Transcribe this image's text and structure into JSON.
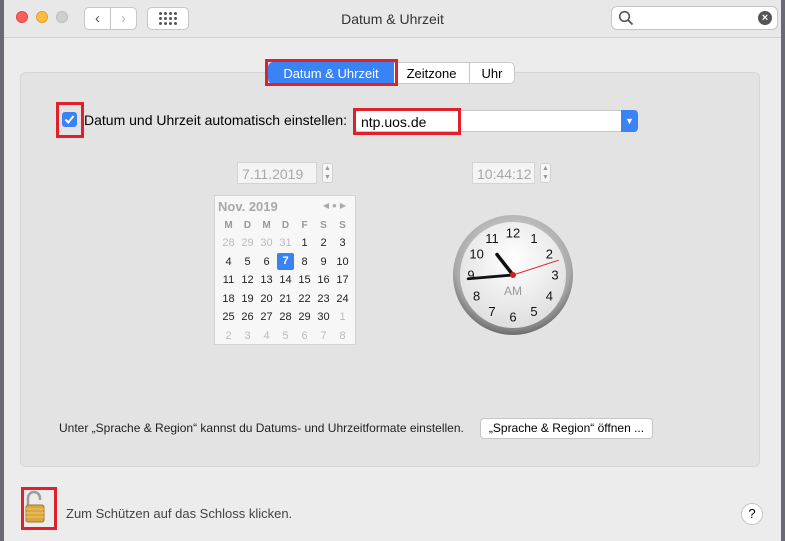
{
  "window": {
    "title": "Datum & Uhrzeit"
  },
  "toolbar": {
    "back_label": "‹",
    "forward_label": "›"
  },
  "tabs": [
    {
      "label": "Datum & Uhrzeit",
      "active": true
    },
    {
      "label": "Zeitzone"
    },
    {
      "label": "Uhr"
    }
  ],
  "auto_time": {
    "checked": true,
    "label": "Datum und Uhrzeit automatisch einstellen:",
    "server": "ntp.uos.de"
  },
  "date_field": {
    "value": "7.11.2019"
  },
  "time_field": {
    "value": "10:44:12"
  },
  "calendar": {
    "header": "Nov. 2019",
    "weekdays": [
      "M",
      "D",
      "M",
      "D",
      "F",
      "S",
      "S"
    ],
    "weeks": [
      [
        "28",
        "29",
        "30",
        "31",
        "1",
        "2",
        "3"
      ],
      [
        "4",
        "5",
        "6",
        "7",
        "8",
        "9",
        "10"
      ],
      [
        "11",
        "12",
        "13",
        "14",
        "15",
        "16",
        "17"
      ],
      [
        "18",
        "19",
        "20",
        "21",
        "22",
        "23",
        "24"
      ],
      [
        "25",
        "26",
        "27",
        "28",
        "29",
        "30",
        "1"
      ],
      [
        "2",
        "3",
        "4",
        "5",
        "6",
        "7",
        "8"
      ]
    ],
    "selected": "7"
  },
  "clock": {
    "ampm": "AM",
    "numerals": [
      "12",
      "1",
      "2",
      "3",
      "4",
      "5",
      "6",
      "7",
      "8",
      "9",
      "10",
      "11"
    ],
    "hours": 10,
    "minutes": 44,
    "seconds": 12
  },
  "region": {
    "hint": "Unter „Sprache & Region“ kannst du Datums- und Uhrzeitformate einstellen.",
    "button": "„Sprache & Region“ öffnen ..."
  },
  "lock": {
    "text": "Zum Schützen auf das Schloss klicken."
  },
  "help": {
    "label": "?"
  },
  "colors": {
    "accent": "#3a83f5",
    "highlight": "#e0202a",
    "second_hand": "#e0202a"
  }
}
